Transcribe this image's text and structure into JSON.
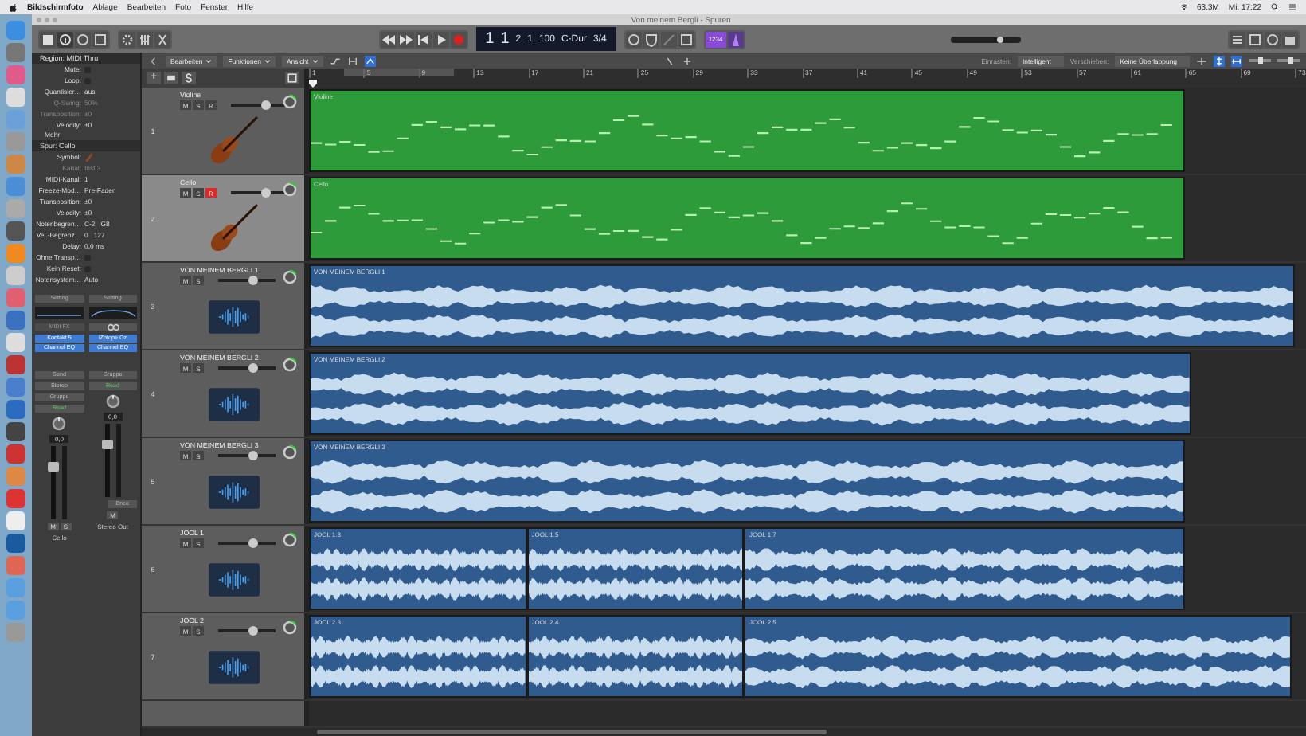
{
  "menubar": {
    "app_name": "Bildschirmfoto",
    "items": [
      "Ablage",
      "Bearbeiten",
      "Foto",
      "Fenster",
      "Hilfe"
    ],
    "status": [
      "63.3M",
      "Mi. 17:22"
    ]
  },
  "window": {
    "title": "Von meinem Bergli - Spuren"
  },
  "transport": {
    "lcd": [
      "1",
      "1",
      "2",
      "1",
      "100",
      "C-Dur",
      "3/4"
    ],
    "count_in": "1234",
    "master_volume": {
      "level": 0.7
    }
  },
  "local_menu": [
    "Bearbeiten",
    "Funktionen",
    "Ansicht"
  ],
  "snap": {
    "label": "Einrasten:",
    "value": "Intelligent"
  },
  "drag": {
    "label": "Verschieben:",
    "value": "Keine Überlappung"
  },
  "track_list": {
    "add_button": "+"
  },
  "zoom": {
    "vertical": {
      "level": 0.5
    },
    "horizontal": {
      "level": 0.6
    }
  },
  "ruler": [
    "1",
    "5",
    "9",
    "13",
    "17",
    "21",
    "25",
    "29",
    "33",
    "37",
    "41",
    "45",
    "49",
    "53",
    "57",
    "61",
    "65",
    "69",
    "73"
  ],
  "inspector": {
    "region": {
      "title": "Region: MIDI Thru",
      "rows": [
        {
          "label": "Mute:",
          "kind": "checkbox",
          "checked": false,
          "disabled": false
        },
        {
          "label": "Loop:",
          "kind": "checkbox",
          "checked": false,
          "disabled": false
        },
        {
          "label": "Quantisier…",
          "kind": "popup",
          "value": "aus",
          "disabled": false
        },
        {
          "label": "Q-Swing:",
          "kind": "value",
          "value": "50%",
          "disabled": true
        },
        {
          "label": "Transposition:",
          "kind": "popup",
          "value": "±0",
          "disabled": true
        },
        {
          "label": "Velocity:",
          "kind": "value",
          "value": "±0",
          "disabled": false
        }
      ],
      "more": "Mehr"
    },
    "track": {
      "title": "Spur: Cello",
      "rows": [
        {
          "label": "Symbol:",
          "kind": "symbol",
          "disabled": false
        },
        {
          "label": "Kanal:",
          "kind": "value",
          "value": "Inst 3",
          "disabled": true
        },
        {
          "label": "MIDI-Kanal:",
          "kind": "popup",
          "value": "1",
          "disabled": false
        },
        {
          "label": "Freeze-Mod…",
          "kind": "popup",
          "value": "Pre-Fader",
          "disabled": false
        },
        {
          "label": "Transposition:",
          "kind": "popup",
          "value": "±0",
          "disabled": false
        },
        {
          "label": "Velocity:",
          "kind": "value",
          "value": "±0",
          "disabled": false
        },
        {
          "label": "Notenbegren…",
          "kind": "value",
          "value": "C-2   G8",
          "disabled": false
        },
        {
          "label": "Vel.-Begrenz…",
          "kind": "value",
          "value": "0   127",
          "disabled": false
        },
        {
          "label": "Delay:",
          "kind": "value",
          "value": "0,0 ms",
          "disabled": false
        },
        {
          "label": "Ohne Transp…",
          "kind": "checkbox",
          "checked": false,
          "disabled": false
        },
        {
          "label": "Kein Reset:",
          "kind": "checkbox",
          "checked": false,
          "disabled": false
        },
        {
          "label": "Notensystem…",
          "kind": "popup",
          "value": "Auto",
          "disabled": false
        }
      ]
    }
  },
  "channel_strips": [
    {
      "name": "Cello",
      "setting": "Setting",
      "midi_fx": "MIDI FX",
      "inserts": [
        "Kontakt 5",
        "Channel EQ"
      ],
      "send": "Send",
      "output": "Stereo",
      "group": "Gruppe",
      "automation": "Read",
      "volume": "0,0",
      "buttons": [
        "M",
        "S"
      ],
      "fader": {
        "level": 0.72
      }
    },
    {
      "name": "Stereo Out",
      "setting": "Setting",
      "inserts": [
        "iZotope Oz",
        "Channel EQ"
      ],
      "group": "Gruppe",
      "automation": "Read",
      "volume": "0,0",
      "bounce": "Bnce",
      "buttons": [
        "M"
      ],
      "fader": {
        "level": 0.72
      }
    }
  ],
  "tracks": [
    {
      "number": "1",
      "name": "Violine",
      "kind": "midi",
      "selected": false,
      "record_armed": false,
      "buttons": [
        "M",
        "S",
        "R"
      ],
      "volume": {
        "level": 0.62
      },
      "regions": [
        {
          "name": "Violine"
        }
      ]
    },
    {
      "number": "2",
      "name": "Cello",
      "kind": "midi",
      "selected": true,
      "record_armed": true,
      "buttons": [
        "M",
        "S",
        "R"
      ],
      "volume": {
        "level": 0.62
      },
      "regions": [
        {
          "name": "Cello"
        }
      ]
    },
    {
      "number": "3",
      "name": "VON MEINEM BERGLI 1",
      "kind": "audio",
      "selected": false,
      "buttons": [
        "M",
        "S"
      ],
      "volume": {
        "level": 0.62
      },
      "regions": [
        {
          "name": "VON MEINEM BERGLI 1"
        }
      ]
    },
    {
      "number": "4",
      "name": "VON MEINEM BERGLI 2",
      "kind": "audio",
      "selected": false,
      "buttons": [
        "M",
        "S"
      ],
      "volume": {
        "level": 0.62
      },
      "regions": [
        {
          "name": "VON MEINEM BERGLI 2"
        }
      ]
    },
    {
      "number": "5",
      "name": "VON MEINEM BERGLI 3",
      "kind": "audio",
      "selected": false,
      "buttons": [
        "M",
        "S"
      ],
      "volume": {
        "level": 0.62
      },
      "regions": [
        {
          "name": "VON MEINEM BERGLI 3"
        }
      ]
    },
    {
      "number": "6",
      "name": "JOOL 1",
      "kind": "audio",
      "selected": false,
      "buttons": [
        "M",
        "S"
      ],
      "volume": {
        "level": 0.62
      },
      "regions": [
        {
          "name": "JOOL 1.3"
        },
        {
          "name": "JOOL 1.5"
        },
        {
          "name": "JOOL 1.7"
        }
      ]
    },
    {
      "number": "7",
      "name": "JOOL 2",
      "kind": "audio",
      "selected": false,
      "buttons": [
        "M",
        "S"
      ],
      "volume": {
        "level": 0.62
      },
      "regions": [
        {
          "name": "JOOL 2.3"
        },
        {
          "name": "JOOL 2.4"
        },
        {
          "name": "JOOL 2.5"
        }
      ]
    }
  ]
}
